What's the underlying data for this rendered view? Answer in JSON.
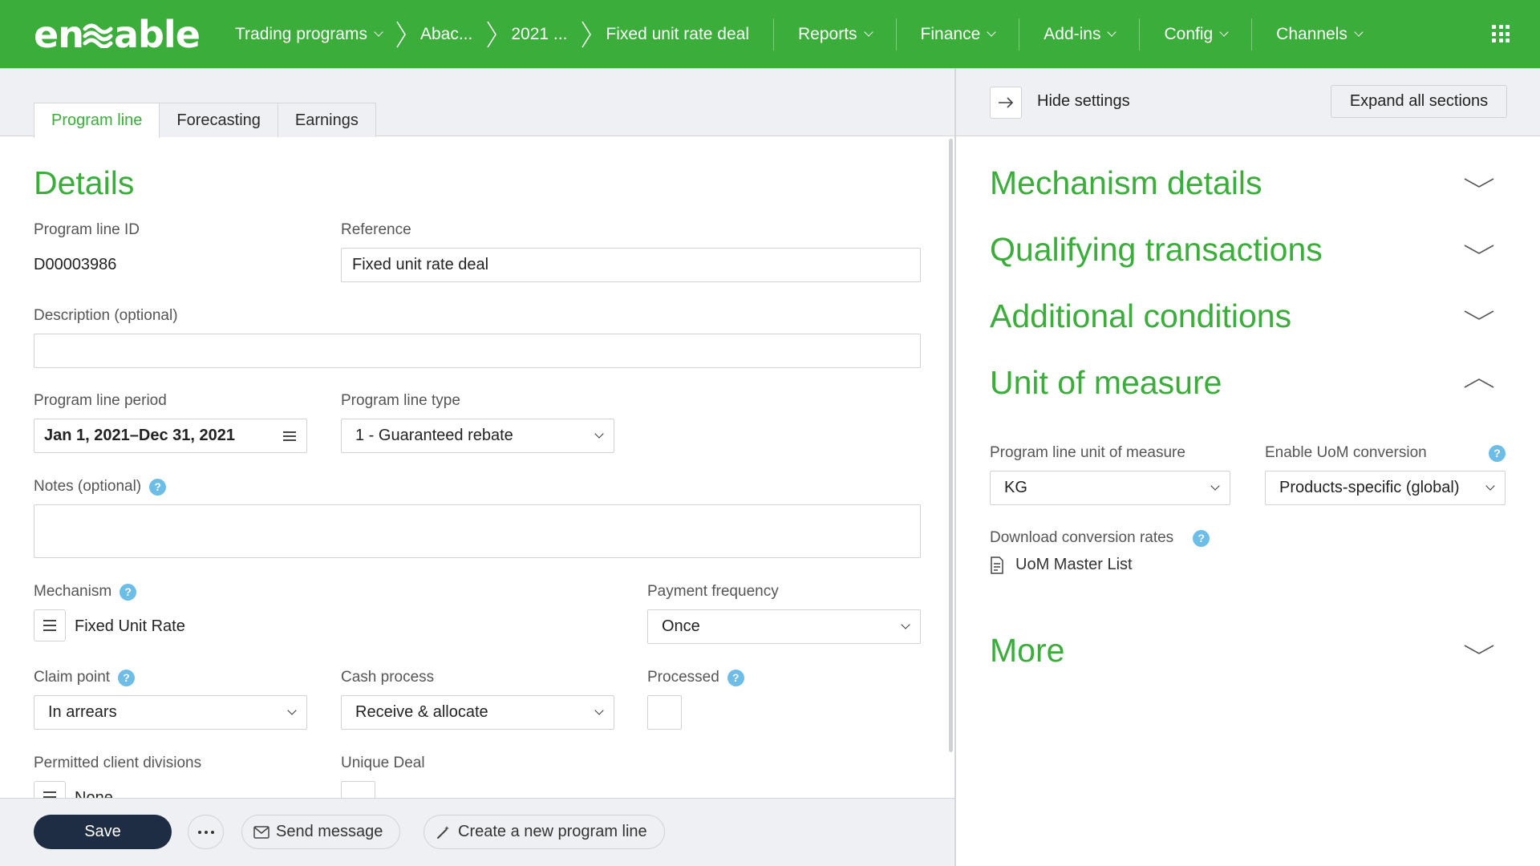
{
  "brand": {
    "logo_text_left": "en",
    "logo_text_right": "able"
  },
  "nav": {
    "breadcrumbs": [
      {
        "label": "Trading programs"
      },
      {
        "label": "Abac..."
      },
      {
        "label": "2021 ..."
      },
      {
        "label": "Fixed unit rate deal"
      }
    ],
    "menus": [
      "Reports",
      "Finance",
      "Add-ins",
      "Config",
      "Channels"
    ]
  },
  "tabs": [
    "Program line",
    "Forecasting",
    "Earnings"
  ],
  "details": {
    "heading": "Details",
    "program_line_id_label": "Program line ID",
    "program_line_id": "D00003986",
    "reference_label": "Reference",
    "reference_value": "Fixed unit rate deal",
    "description_label": "Description (optional)",
    "description_value": "",
    "period_label": "Program line period",
    "period_value": "Jan 1, 2021–Dec 31, 2021",
    "type_label": "Program line type",
    "type_value": "1 - Guaranteed rebate",
    "notes_label": "Notes (optional)",
    "notes_value": "",
    "mechanism_label": "Mechanism",
    "mechanism_value": "Fixed Unit Rate",
    "payment_frequency_label": "Payment frequency",
    "payment_frequency_value": "Once",
    "claim_point_label": "Claim point",
    "claim_point_value": "In arrears",
    "cash_process_label": "Cash process",
    "cash_process_value": "Receive & allocate",
    "processed_label": "Processed",
    "permitted_divisions_label": "Permitted client divisions",
    "permitted_divisions_value": "None",
    "unique_deal_label": "Unique Deal"
  },
  "actions": {
    "save": "Save",
    "send_message": "Send message",
    "create_line": "Create a new program line"
  },
  "settings": {
    "hide_label": "Hide settings",
    "expand_all": "Expand all sections",
    "sections": {
      "mechanism": "Mechanism details",
      "qualifying": "Qualifying transactions",
      "additional": "Additional conditions",
      "uom": "Unit of measure",
      "more": "More"
    },
    "uom": {
      "line_uom_label": "Program line unit of measure",
      "line_uom_value": "KG",
      "conversion_label": "Enable UoM conversion",
      "conversion_value": "Products-specific (global)",
      "download_label": "Download conversion rates",
      "master_list": "UoM Master List"
    }
  },
  "colors": {
    "brand_green": "#3aad3a",
    "save_navy": "#1f2d44",
    "help_blue": "#6cbde8"
  },
  "icons": [
    "apps-grid-icon",
    "calendar-list-icon",
    "help-icon",
    "list-icon",
    "envelope-icon",
    "wand-icon",
    "arrow-right-icon",
    "chevron-down-icon",
    "chevron-up-icon",
    "document-icon"
  ]
}
